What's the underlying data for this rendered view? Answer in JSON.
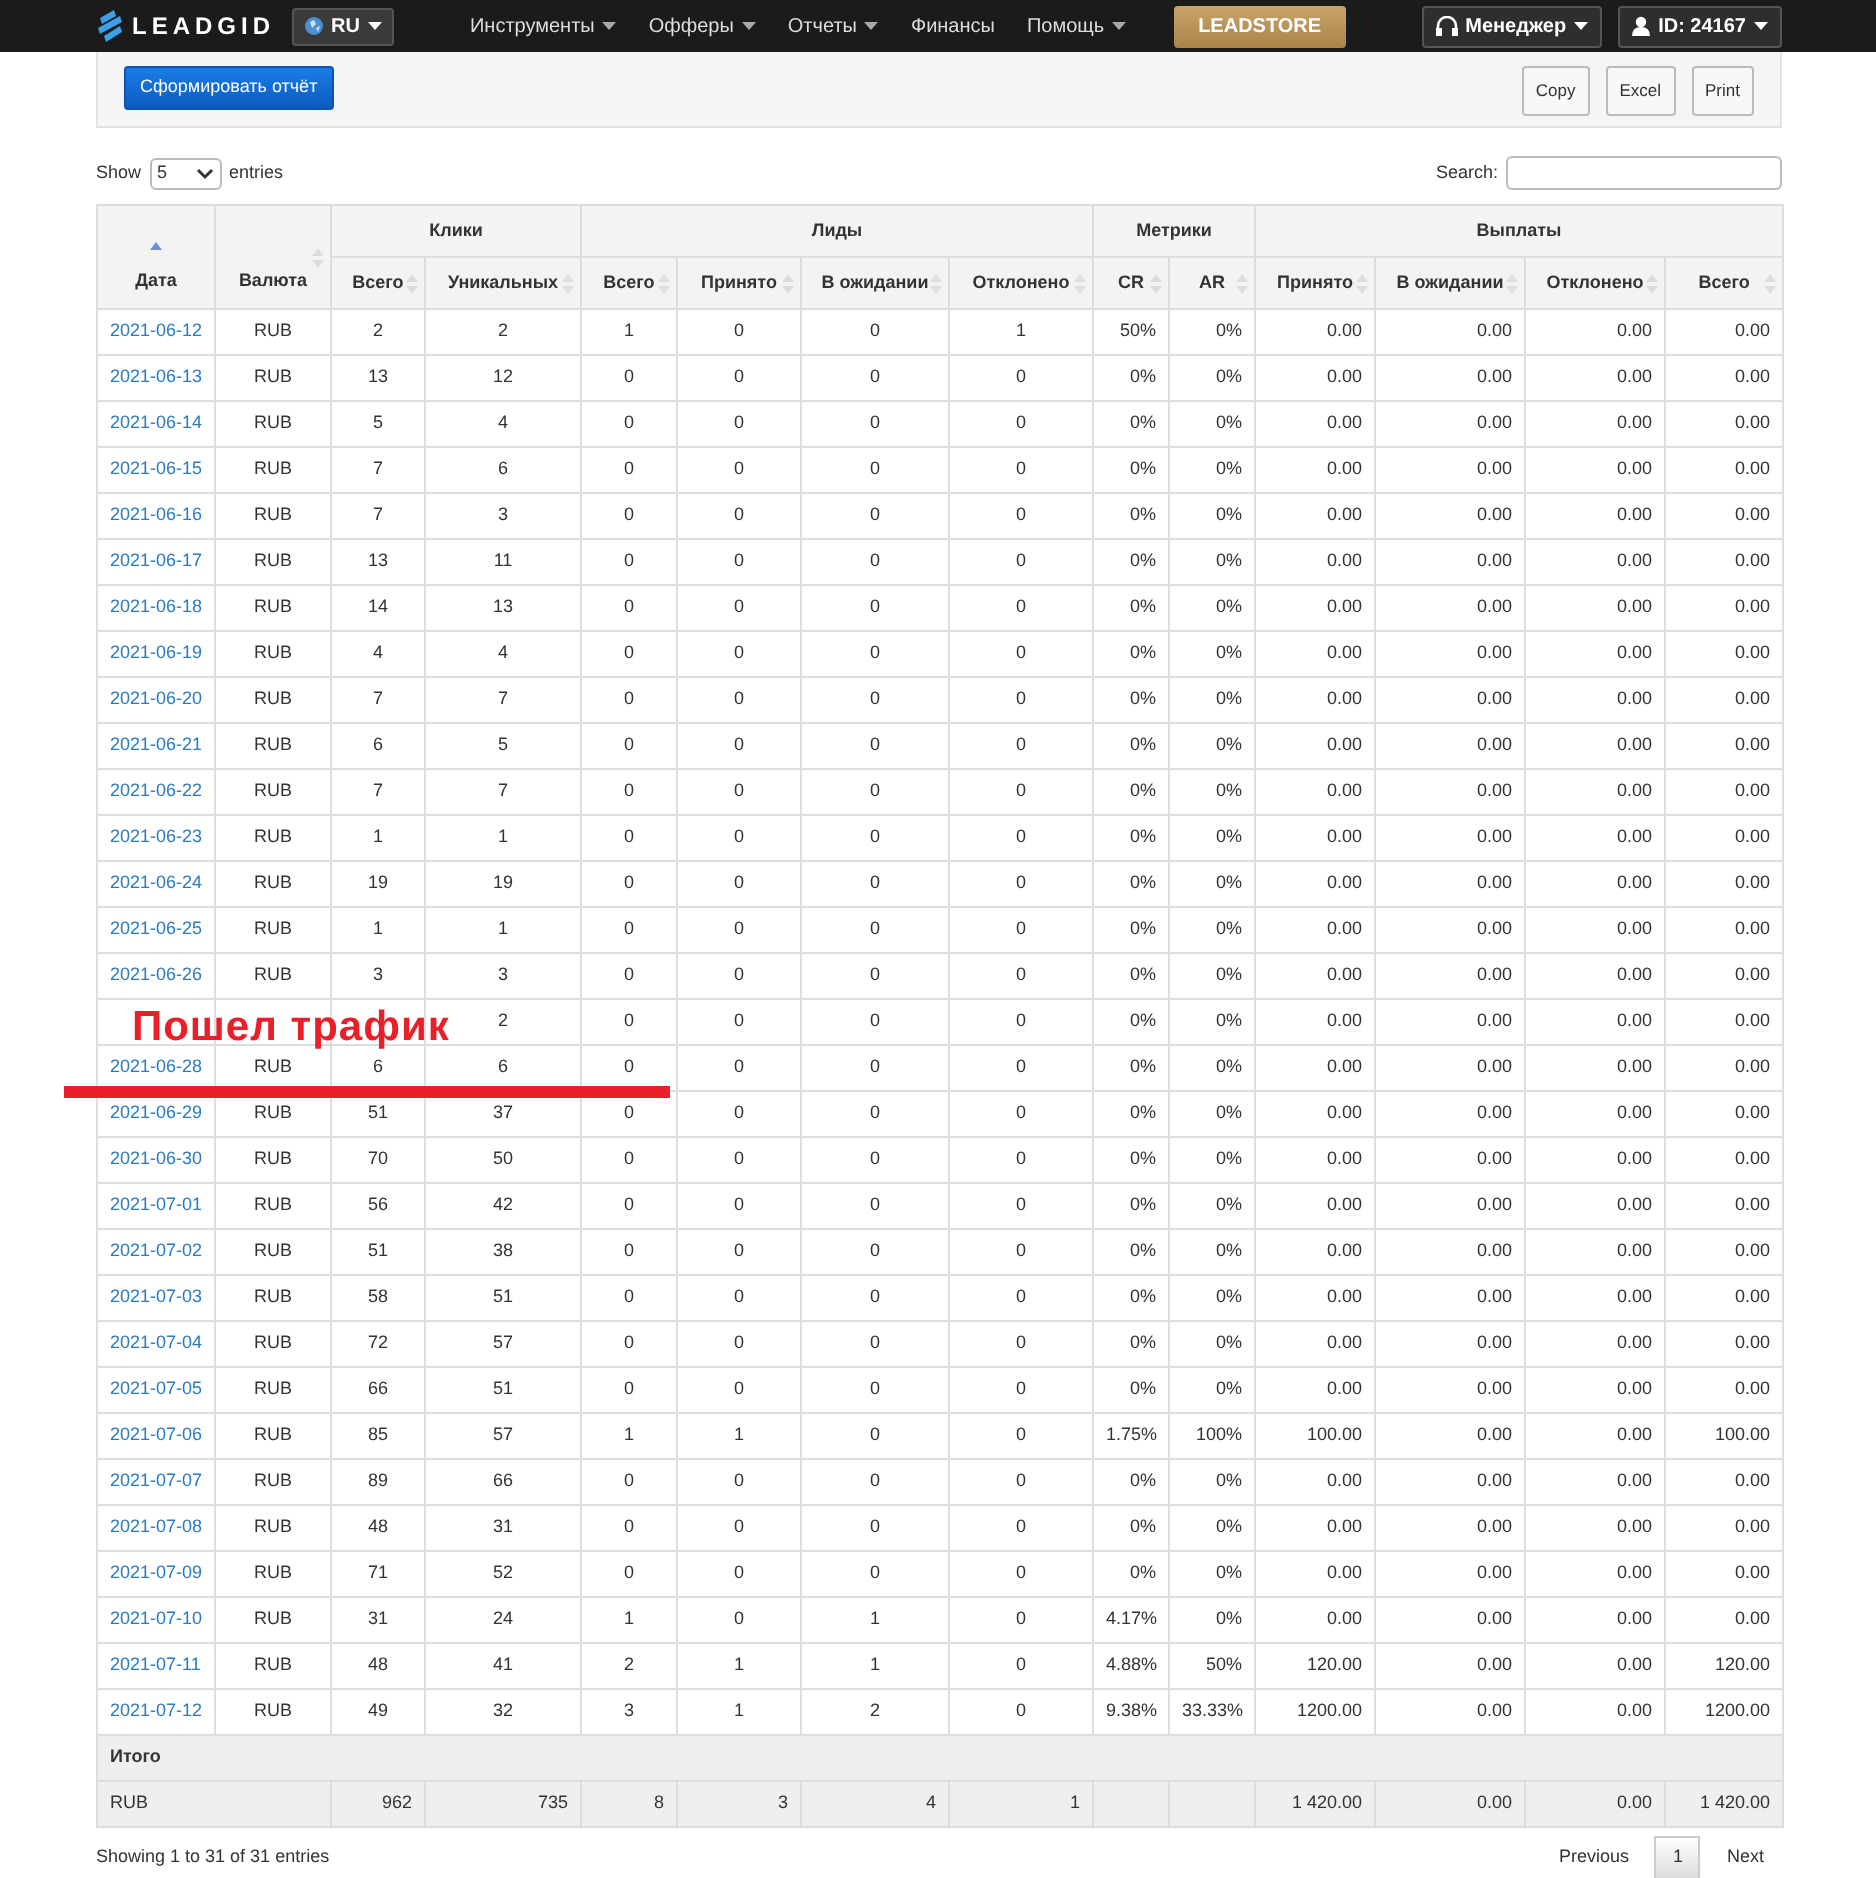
{
  "navbar": {
    "brand": "LEADGID",
    "language": "RU",
    "menu": [
      {
        "label": "Инструменты",
        "dropdown": true
      },
      {
        "label": "Офферы",
        "dropdown": true
      },
      {
        "label": "Отчеты",
        "dropdown": true
      },
      {
        "label": "Финансы",
        "dropdown": false
      },
      {
        "label": "Помощь",
        "dropdown": true
      }
    ],
    "store": "LEADSTORE",
    "manager": "Менеджер",
    "user": "ID: 24167"
  },
  "toolbar": {
    "report_button": "Сформировать отчёт",
    "exports": [
      "Copy",
      "Excel",
      "Print"
    ]
  },
  "length": {
    "before": "Show",
    "value": "5",
    "after": "entries"
  },
  "search": {
    "label": "Search:"
  },
  "table": {
    "columns": [
      {
        "label": "Дата",
        "sorted": true
      },
      {
        "label": "Валюта",
        "sorted": false
      }
    ],
    "groups": [
      {
        "label": "Клики",
        "columns": [
          {
            "label": "Всего",
            "sorted": false
          },
          {
            "label": "Уникальных",
            "sorted": false
          }
        ]
      },
      {
        "label": "Лиды",
        "columns": [
          {
            "label": "Всего",
            "sorted": false
          },
          {
            "label": "Принято",
            "sorted": false
          },
          {
            "label": "В ожидании",
            "sorted": false
          },
          {
            "label": "Отклонено",
            "sorted": false
          }
        ]
      },
      {
        "label": "Метрики",
        "columns": [
          {
            "label": "CR",
            "sorted": false
          },
          {
            "label": "AR",
            "sorted": false
          }
        ]
      },
      {
        "label": "Выплаты",
        "columns": [
          {
            "label": "Принято",
            "sorted": false
          },
          {
            "label": "В ожидании",
            "sorted": false
          },
          {
            "label": "Отклонено",
            "sorted": false
          },
          {
            "label": "Всего",
            "sorted": false
          }
        ]
      }
    ],
    "rows": [
      {
        "cells": [
          "2021-06-12",
          "RUB",
          "2",
          "2",
          "1",
          "0",
          "0",
          "1",
          "50%",
          "0%",
          "0.00",
          "0.00",
          "0.00",
          "0.00"
        ]
      },
      {
        "cells": [
          "2021-06-13",
          "RUB",
          "13",
          "12",
          "0",
          "0",
          "0",
          "0",
          "0%",
          "0%",
          "0.00",
          "0.00",
          "0.00",
          "0.00"
        ]
      },
      {
        "cells": [
          "2021-06-14",
          "RUB",
          "5",
          "4",
          "0",
          "0",
          "0",
          "0",
          "0%",
          "0%",
          "0.00",
          "0.00",
          "0.00",
          "0.00"
        ]
      },
      {
        "cells": [
          "2021-06-15",
          "RUB",
          "7",
          "6",
          "0",
          "0",
          "0",
          "0",
          "0%",
          "0%",
          "0.00",
          "0.00",
          "0.00",
          "0.00"
        ]
      },
      {
        "cells": [
          "2021-06-16",
          "RUB",
          "7",
          "3",
          "0",
          "0",
          "0",
          "0",
          "0%",
          "0%",
          "0.00",
          "0.00",
          "0.00",
          "0.00"
        ]
      },
      {
        "cells": [
          "2021-06-17",
          "RUB",
          "13",
          "11",
          "0",
          "0",
          "0",
          "0",
          "0%",
          "0%",
          "0.00",
          "0.00",
          "0.00",
          "0.00"
        ]
      },
      {
        "cells": [
          "2021-06-18",
          "RUB",
          "14",
          "13",
          "0",
          "0",
          "0",
          "0",
          "0%",
          "0%",
          "0.00",
          "0.00",
          "0.00",
          "0.00"
        ]
      },
      {
        "cells": [
          "2021-06-19",
          "RUB",
          "4",
          "4",
          "0",
          "0",
          "0",
          "0",
          "0%",
          "0%",
          "0.00",
          "0.00",
          "0.00",
          "0.00"
        ]
      },
      {
        "cells": [
          "2021-06-20",
          "RUB",
          "7",
          "7",
          "0",
          "0",
          "0",
          "0",
          "0%",
          "0%",
          "0.00",
          "0.00",
          "0.00",
          "0.00"
        ]
      },
      {
        "cells": [
          "2021-06-21",
          "RUB",
          "6",
          "5",
          "0",
          "0",
          "0",
          "0",
          "0%",
          "0%",
          "0.00",
          "0.00",
          "0.00",
          "0.00"
        ]
      },
      {
        "cells": [
          "2021-06-22",
          "RUB",
          "7",
          "7",
          "0",
          "0",
          "0",
          "0",
          "0%",
          "0%",
          "0.00",
          "0.00",
          "0.00",
          "0.00"
        ]
      },
      {
        "cells": [
          "2021-06-23",
          "RUB",
          "1",
          "1",
          "0",
          "0",
          "0",
          "0",
          "0%",
          "0%",
          "0.00",
          "0.00",
          "0.00",
          "0.00"
        ]
      },
      {
        "cells": [
          "2021-06-24",
          "RUB",
          "19",
          "19",
          "0",
          "0",
          "0",
          "0",
          "0%",
          "0%",
          "0.00",
          "0.00",
          "0.00",
          "0.00"
        ]
      },
      {
        "cells": [
          "2021-06-25",
          "RUB",
          "1",
          "1",
          "0",
          "0",
          "0",
          "0",
          "0%",
          "0%",
          "0.00",
          "0.00",
          "0.00",
          "0.00"
        ]
      },
      {
        "cells": [
          "2021-06-26",
          "RUB",
          "3",
          "3",
          "0",
          "0",
          "0",
          "0",
          "0%",
          "0%",
          "0.00",
          "0.00",
          "0.00",
          "0.00"
        ]
      },
      {
        "cells": [
          null,
          null,
          null,
          "2",
          "0",
          "0",
          "0",
          "0",
          "0%",
          "0%",
          "0.00",
          "0.00",
          "0.00",
          "0.00"
        ]
      },
      {
        "cells": [
          "2021-06-28",
          "RUB",
          "6",
          "6",
          "0",
          "0",
          "0",
          "0",
          "0%",
          "0%",
          "0.00",
          "0.00",
          "0.00",
          "0.00"
        ]
      },
      {
        "cells": [
          "2021-06-29",
          "RUB",
          "51",
          "37",
          "0",
          "0",
          "0",
          "0",
          "0%",
          "0%",
          "0.00",
          "0.00",
          "0.00",
          "0.00"
        ]
      },
      {
        "cells": [
          "2021-06-30",
          "RUB",
          "70",
          "50",
          "0",
          "0",
          "0",
          "0",
          "0%",
          "0%",
          "0.00",
          "0.00",
          "0.00",
          "0.00"
        ]
      },
      {
        "cells": [
          "2021-07-01",
          "RUB",
          "56",
          "42",
          "0",
          "0",
          "0",
          "0",
          "0%",
          "0%",
          "0.00",
          "0.00",
          "0.00",
          "0.00"
        ]
      },
      {
        "cells": [
          "2021-07-02",
          "RUB",
          "51",
          "38",
          "0",
          "0",
          "0",
          "0",
          "0%",
          "0%",
          "0.00",
          "0.00",
          "0.00",
          "0.00"
        ]
      },
      {
        "cells": [
          "2021-07-03",
          "RUB",
          "58",
          "51",
          "0",
          "0",
          "0",
          "0",
          "0%",
          "0%",
          "0.00",
          "0.00",
          "0.00",
          "0.00"
        ]
      },
      {
        "cells": [
          "2021-07-04",
          "RUB",
          "72",
          "57",
          "0",
          "0",
          "0",
          "0",
          "0%",
          "0%",
          "0.00",
          "0.00",
          "0.00",
          "0.00"
        ]
      },
      {
        "cells": [
          "2021-07-05",
          "RUB",
          "66",
          "51",
          "0",
          "0",
          "0",
          "0",
          "0%",
          "0%",
          "0.00",
          "0.00",
          "0.00",
          "0.00"
        ]
      },
      {
        "cells": [
          "2021-07-06",
          "RUB",
          "85",
          "57",
          "1",
          "1",
          "0",
          "0",
          "1.75%",
          "100%",
          "100.00",
          "0.00",
          "0.00",
          "100.00"
        ]
      },
      {
        "cells": [
          "2021-07-07",
          "RUB",
          "89",
          "66",
          "0",
          "0",
          "0",
          "0",
          "0%",
          "0%",
          "0.00",
          "0.00",
          "0.00",
          "0.00"
        ]
      },
      {
        "cells": [
          "2021-07-08",
          "RUB",
          "48",
          "31",
          "0",
          "0",
          "0",
          "0",
          "0%",
          "0%",
          "0.00",
          "0.00",
          "0.00",
          "0.00"
        ]
      },
      {
        "cells": [
          "2021-07-09",
          "RUB",
          "71",
          "52",
          "0",
          "0",
          "0",
          "0",
          "0%",
          "0%",
          "0.00",
          "0.00",
          "0.00",
          "0.00"
        ]
      },
      {
        "cells": [
          "2021-07-10",
          "RUB",
          "31",
          "24",
          "1",
          "0",
          "1",
          "0",
          "4.17%",
          "0%",
          "0.00",
          "0.00",
          "0.00",
          "0.00"
        ]
      },
      {
        "cells": [
          "2021-07-11",
          "RUB",
          "48",
          "41",
          "2",
          "1",
          "1",
          "0",
          "4.88%",
          "50%",
          "120.00",
          "0.00",
          "0.00",
          "120.00"
        ]
      },
      {
        "cells": [
          "2021-07-12",
          "RUB",
          "49",
          "32",
          "3",
          "1",
          "2",
          "0",
          "9.38%",
          "33.33%",
          "1200.00",
          "0.00",
          "0.00",
          "1200.00"
        ]
      }
    ],
    "totals_title": "Итого",
    "totals": {
      "currency": "RUB",
      "cells": [
        "962",
        "735",
        "8",
        "3",
        "4",
        "1",
        null,
        null,
        "1 420.00",
        "0.00",
        "0.00",
        "1 420.00"
      ]
    }
  },
  "annotation": {
    "text": "Пошел трафик"
  },
  "info": "Showing 1 to 31 of 31 entries",
  "pagination": [
    {
      "label": "Previous",
      "selected": false
    },
    {
      "label": "1",
      "selected": true
    },
    {
      "label": "Next",
      "selected": false
    }
  ]
}
